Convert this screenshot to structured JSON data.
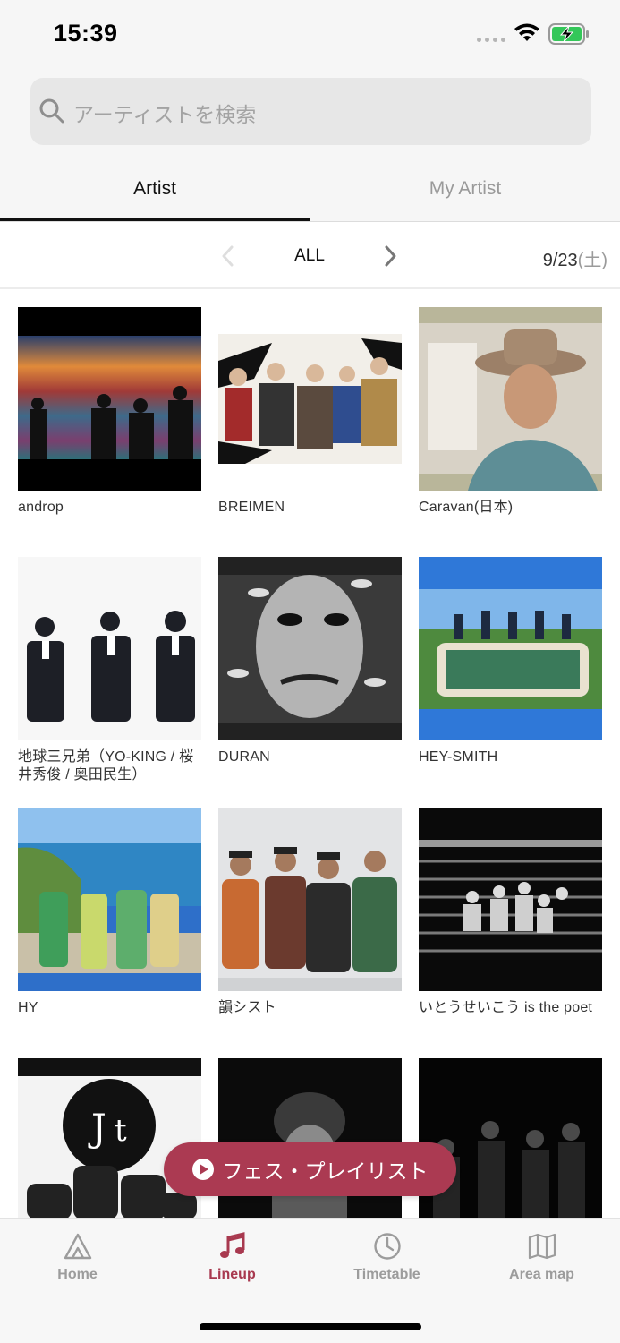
{
  "status": {
    "time": "15:39"
  },
  "search": {
    "placeholder": "アーティストを検索"
  },
  "tabs": [
    {
      "label": "Artist",
      "active": true
    },
    {
      "label": "My Artist",
      "active": false
    }
  ],
  "filter": {
    "label": "ALL",
    "date": "9/23",
    "weekday": "(土)"
  },
  "artists": [
    {
      "name": "androp"
    },
    {
      "name": "BREIMEN"
    },
    {
      "name": "Caravan(日本)"
    },
    {
      "name": "地球三兄弟（YO-KING / 桜井秀俊 / 奥田民生）"
    },
    {
      "name": "DURAN"
    },
    {
      "name": "HEY-SMITH"
    },
    {
      "name": "HY"
    },
    {
      "name": "韻シスト"
    },
    {
      "name": "いとうせいこう is the poet"
    }
  ],
  "playlist_button": {
    "label": "フェス・プレイリスト"
  },
  "nav": [
    {
      "label": "Home",
      "icon": "home-icon",
      "active": false
    },
    {
      "label": "Lineup",
      "icon": "music-note-icon",
      "active": true
    },
    {
      "label": "Timetable",
      "icon": "clock-icon",
      "active": false
    },
    {
      "label": "Area map",
      "icon": "map-icon",
      "active": false
    }
  ],
  "colors": {
    "accent": "#ab3a52",
    "nav_active": "#a8394f",
    "battery": "#34c759"
  }
}
